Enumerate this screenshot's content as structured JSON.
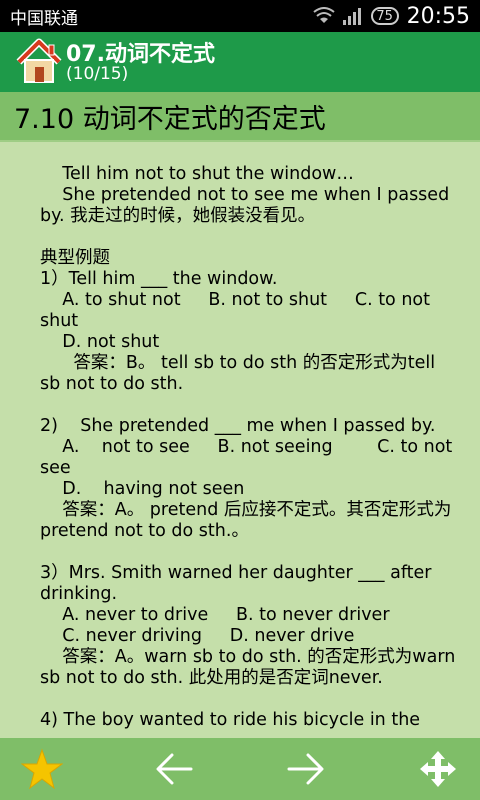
{
  "status_bar": {
    "carrier": "中国联通",
    "battery": "75",
    "time": "20:55"
  },
  "title_bar": {
    "title": "07.动词不定式",
    "subtitle": "(10/15)"
  },
  "section": {
    "heading": "7.10 动词不定式的否定式"
  },
  "content": {
    "lines": [
      "    Tell him not to shut the window…",
      "    She pretended not to see me when I passed by. 我走过的时候，她假装没看见。",
      "",
      "典型例题",
      "1）Tell him ___ the window.",
      "    A. to shut not     B. not to shut     C. to not shut",
      "    D. not shut",
      "      答案：B。 tell sb to do sth 的否定形式为tell sb not to do sth.",
      "",
      "2)    She pretended ___ me when I passed by.",
      "    A.    not to see     B. not seeing        C. to not see",
      "    D.    having not seen",
      "    答案：A。 pretend 后应接不定式。其否定形式为pretend not to do sth.。",
      "",
      "3）Mrs. Smith warned her daughter ___ after drinking.",
      "    A. never to drive     B. to never driver",
      "    C. never driving     D. never drive",
      "    答案：A。warn sb to do sth. 的否定形式为warn sb not to do sth. 此处用的是否定词never.",
      "",
      "4) The boy wanted to ride his bicycle in the"
    ]
  },
  "bottom_bar": {
    "colors": {
      "star": "#f5c400",
      "arrows": "#ffffff"
    }
  }
}
